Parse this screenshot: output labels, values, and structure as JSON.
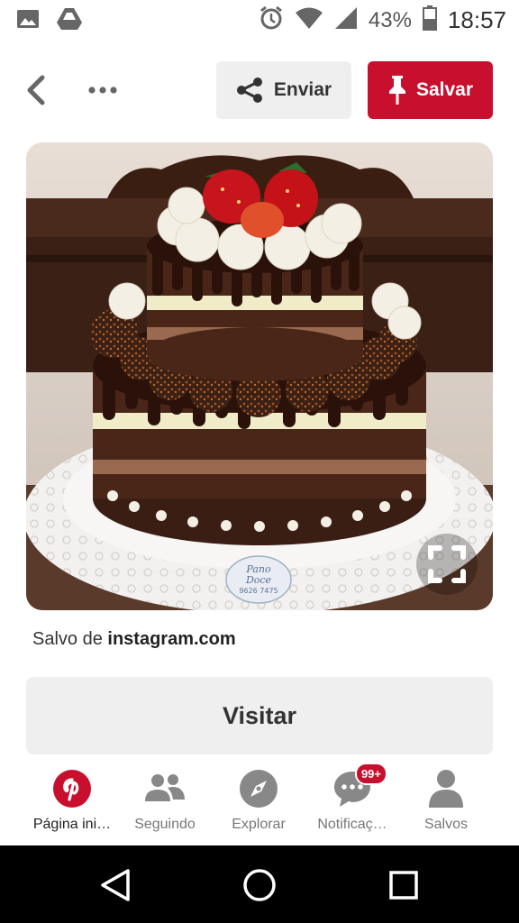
{
  "status_bar": {
    "battery": "43%",
    "time": "18:57",
    "icons": [
      "image-icon",
      "drive-icon",
      "alarm-icon",
      "wifi-icon",
      "signal-icon",
      "battery-icon"
    ]
  },
  "topbar": {
    "back_icon": "chevron-left-icon",
    "more_icon": "more-horizontal-icon",
    "send_label": "Enviar",
    "save_label": "Salvar"
  },
  "pin": {
    "image_alt": "Naked cake de chocolate com morangos",
    "watermark_line1": "Pano",
    "watermark_line2": "Doce",
    "watermark_phone": "9626 7475",
    "saved_prefix": "Salvo de ",
    "saved_source": "instagram.com",
    "visit_label": "Visitar"
  },
  "bottom_nav": {
    "items": [
      {
        "label": "Página ini…",
        "icon": "pinterest-logo-icon",
        "active": true
      },
      {
        "label": "Seguindo",
        "icon": "people-icon",
        "active": false
      },
      {
        "label": "Explorar",
        "icon": "compass-icon",
        "active": false
      },
      {
        "label": "Notificaç…",
        "icon": "chat-bubble-icon",
        "active": false,
        "badge": "99+"
      },
      {
        "label": "Salvos",
        "icon": "person-icon",
        "active": false
      }
    ]
  },
  "colors": {
    "brand_red": "#c8102e",
    "button_grey": "#efefef"
  }
}
